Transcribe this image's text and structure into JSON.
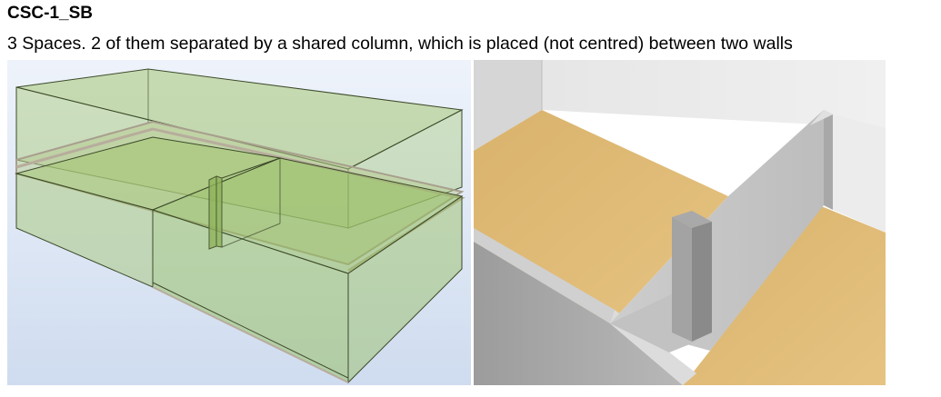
{
  "header": {
    "title": "CSC-1_SB",
    "description": "3 Spaces. 2 of them separated by a shared column, which is placed (not centred) between two walls"
  },
  "colors": {
    "space_fill": "#9fc36a",
    "space_edge": "#3d4a2a",
    "slab_edge": "#b9b0a0",
    "floor": "#dcb46e",
    "wall": "#c8c8c8",
    "background_left": "#dde6f4"
  }
}
